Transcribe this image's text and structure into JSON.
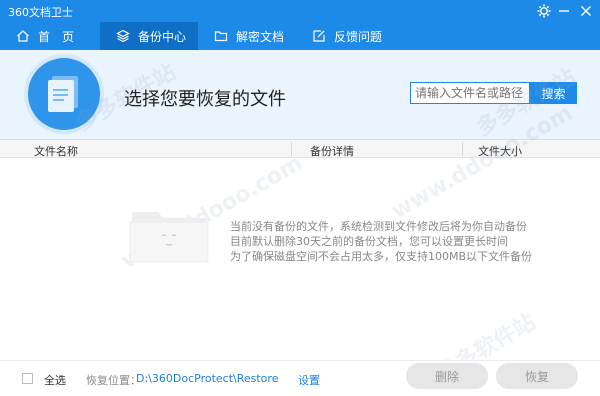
{
  "titlebar": {
    "app_title": "360文档卫士"
  },
  "nav": {
    "tabs": [
      {
        "label": "首　页",
        "icon": "home-icon"
      },
      {
        "label": "备份中心",
        "icon": "layers-icon",
        "active": true
      },
      {
        "label": "解密文档",
        "icon": "folder-icon"
      },
      {
        "label": "反馈问题",
        "icon": "edit-icon"
      }
    ]
  },
  "banner": {
    "heading": "选择您要恢复的文件",
    "search_placeholder": "请输入文件名或路径",
    "search_button": "搜索"
  },
  "table": {
    "columns": [
      "文件名称",
      "备份详情",
      "文件大小"
    ]
  },
  "empty_state": {
    "lines": [
      "当前没有备份的文件，系统检测到文件修改后将为你自动备份",
      "目前默认删除30天之前的备份文档，您可以设置更长时间",
      "为了确保磁盘空间不会占用太多，仅支持100MB以下文件备份"
    ]
  },
  "footer": {
    "select_all": "全选",
    "restore_location_label": "恢复位置：",
    "restore_path": "D:\\360DocProtect\\Restore",
    "settings": "设置",
    "delete": "删除",
    "restore": "恢复"
  },
  "watermark": {
    "text": "www.ddooo.com",
    "cn": "多多软件站"
  },
  "colors": {
    "accent": "#1e8ae8",
    "nav_active": "#0f6fc6",
    "banner_bg": "#eaf4fd"
  }
}
